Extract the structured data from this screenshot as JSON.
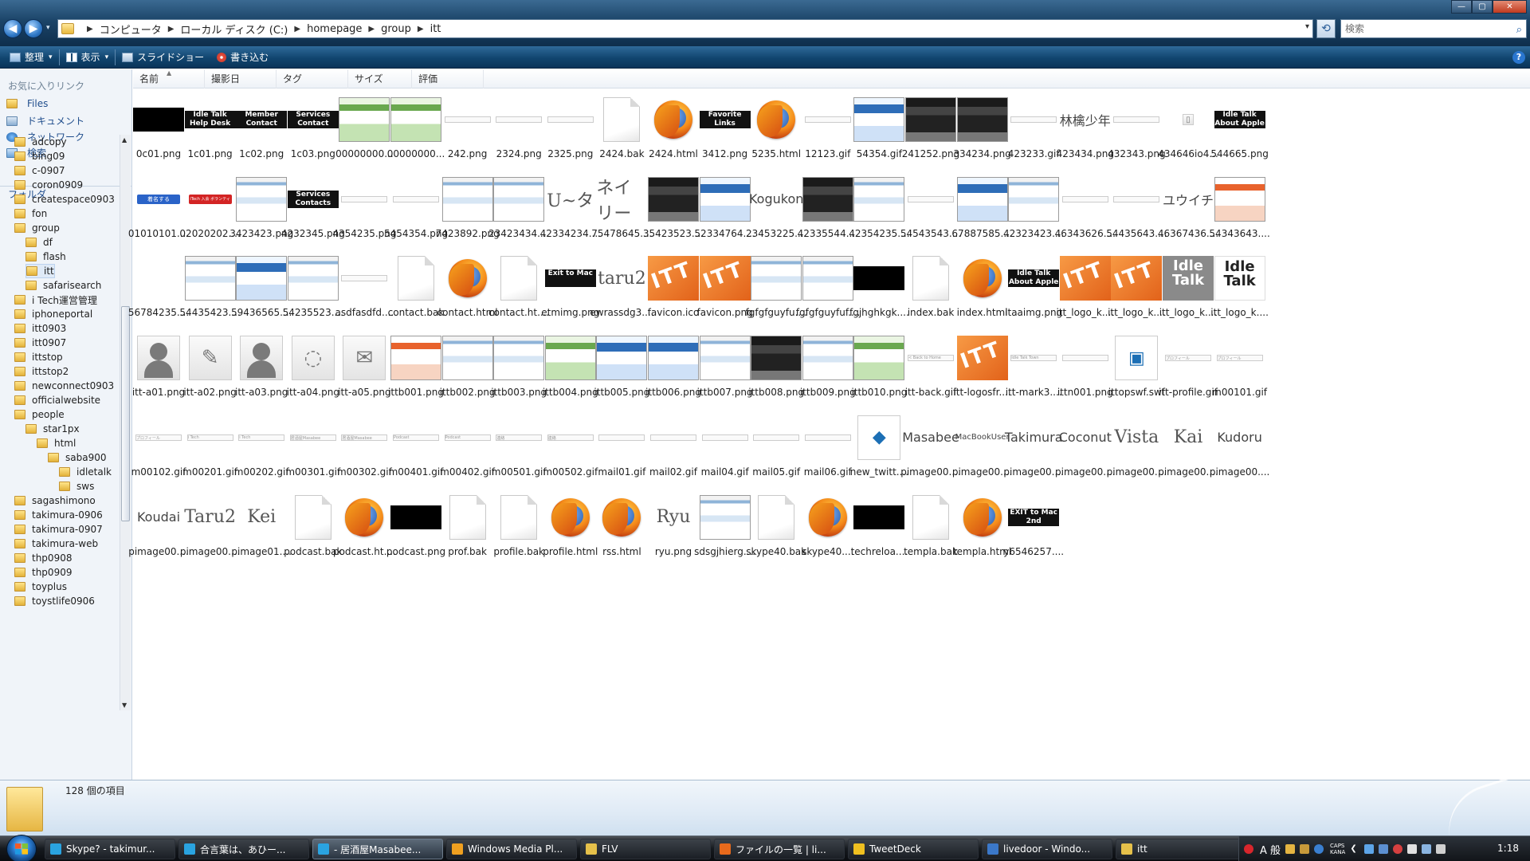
{
  "window": {
    "address": {
      "crumbs": [
        "コンピュータ",
        "ローカル ディスク (C:)",
        "homepage",
        "group",
        "itt"
      ]
    },
    "search_placeholder": "検索",
    "caption": {
      "minimize": "—",
      "maximize": "▢",
      "close": "✕"
    }
  },
  "toolbar": {
    "organize": "整理",
    "views": "表示",
    "slideshow": "スライドショー",
    "burn": "書き込む",
    "help": "?"
  },
  "nav": {
    "favorites_heading": "お気に入りリンク",
    "favorites": [
      "Files",
      "ドキュメント",
      "ネットワーク",
      "検索"
    ],
    "folders_heading": "フォルダ",
    "tree": [
      {
        "label": "adcopy",
        "level": 0
      },
      {
        "label": "bing09",
        "level": 0
      },
      {
        "label": "c-0907",
        "level": 0
      },
      {
        "label": "coron0909",
        "level": 0
      },
      {
        "label": "createspace0903",
        "level": 0
      },
      {
        "label": "fon",
        "level": 0
      },
      {
        "label": "group",
        "level": 0
      },
      {
        "label": "df",
        "level": 1
      },
      {
        "label": "flash",
        "level": 1
      },
      {
        "label": "itt",
        "level": 1,
        "selected": true
      },
      {
        "label": "safarisearch",
        "level": 1
      },
      {
        "label": "i Tech運営管理",
        "level": 0
      },
      {
        "label": "iphoneportal",
        "level": 0
      },
      {
        "label": "itt0903",
        "level": 0
      },
      {
        "label": "itt0907",
        "level": 0
      },
      {
        "label": "ittstop",
        "level": 0
      },
      {
        "label": "ittstop2",
        "level": 0
      },
      {
        "label": "newconnect0903",
        "level": 0
      },
      {
        "label": "officialwebsite",
        "level": 0
      },
      {
        "label": "people",
        "level": 0
      },
      {
        "label": "star1px",
        "level": 1
      },
      {
        "label": "html",
        "level": 2
      },
      {
        "label": "saba900",
        "level": 3
      },
      {
        "label": "idletalk",
        "level": 4
      },
      {
        "label": "sws",
        "level": 4
      },
      {
        "label": "sagashimono",
        "level": 0
      },
      {
        "label": "takimura-0906",
        "level": 0
      },
      {
        "label": "takimura-0907",
        "level": 0
      },
      {
        "label": "takimura-web",
        "level": 0
      },
      {
        "label": "thp0908",
        "level": 0
      },
      {
        "label": "thp0909",
        "level": 0
      },
      {
        "label": "toyplus",
        "level": 0
      },
      {
        "label": "toystlife0906",
        "level": 0
      }
    ]
  },
  "columns": [
    "名前",
    "撮影日",
    "タグ",
    "サイズ",
    "評価"
  ],
  "files": [
    [
      {
        "name": "0c01.png",
        "kind": "black"
      },
      {
        "name": "1c01.png",
        "kind": "dark",
        "text": "Idle Talk Help Desk"
      },
      {
        "name": "1c02.png",
        "kind": "dark",
        "text": "Member Contact"
      },
      {
        "name": "1c03.png",
        "kind": "dark",
        "text": "Services Contact"
      },
      {
        "name": "00000000...",
        "kind": "shot-green"
      },
      {
        "name": "00000000...",
        "kind": "shot-green"
      },
      {
        "name": "242.png",
        "kind": "thin"
      },
      {
        "name": "2324.png",
        "kind": "thin"
      },
      {
        "name": "2325.png",
        "kind": "thin"
      },
      {
        "name": "2424.bak",
        "kind": "page"
      },
      {
        "name": "2424.html",
        "kind": "ff"
      },
      {
        "name": "3412.png",
        "kind": "dark",
        "text": "Favorite Links"
      },
      {
        "name": "5235.html",
        "kind": "ff"
      },
      {
        "name": "12123.gif",
        "kind": "thin"
      },
      {
        "name": "54354.gif",
        "kind": "shot-blue"
      },
      {
        "name": "241252.png",
        "kind": "shot-dark"
      },
      {
        "name": "334234.png",
        "kind": "shot-dark"
      },
      {
        "name": "423233.gif",
        "kind": "thin"
      },
      {
        "name": "423434.png",
        "kind": "text-sm",
        "text": "林檎少年"
      },
      {
        "name": "432343.png",
        "kind": "thin"
      },
      {
        "name": "434646io4...",
        "kind": "glyph-sm",
        "text": "▯"
      },
      {
        "name": "544665.png",
        "kind": "dark",
        "text": "Idle Talk About Apple"
      }
    ],
    [
      {
        "name": "01010101....",
        "kind": "btn-blue",
        "text": "着名する"
      },
      {
        "name": "02020202....",
        "kind": "btn-red",
        "text": "iTech 入会 ボランティアワーク"
      },
      {
        "name": "3423423.png",
        "kind": "shot"
      },
      {
        "name": "4232345.png",
        "kind": "dark",
        "text": "Services Contacts"
      },
      {
        "name": "4354235.png",
        "kind": "thin"
      },
      {
        "name": "5454354.png",
        "kind": "thin"
      },
      {
        "name": "7423892.png",
        "kind": "shot"
      },
      {
        "name": "23423434....",
        "kind": "shot"
      },
      {
        "name": "42334234....",
        "kind": "text",
        "text": "U~タ"
      },
      {
        "name": "75478645....",
        "kind": "text",
        "text": "ネイリー"
      },
      {
        "name": "35423523....",
        "kind": "shot-dark"
      },
      {
        "name": "52334764....",
        "kind": "shot-blue"
      },
      {
        "name": "23453225....",
        "kind": "text-sm",
        "text": "Kogukon"
      },
      {
        "name": "42335544....",
        "kind": "shot-dark"
      },
      {
        "name": "42354235....",
        "kind": "shot"
      },
      {
        "name": "54543543....",
        "kind": "thin"
      },
      {
        "name": "67887585....",
        "kind": "shot-blue"
      },
      {
        "name": "42323423....",
        "kind": "shot"
      },
      {
        "name": "46343626....",
        "kind": "thin"
      },
      {
        "name": "54435643....",
        "kind": "thin"
      },
      {
        "name": "46367436....",
        "kind": "text-sm",
        "text": "ユウイチ"
      },
      {
        "name": "54343643....",
        "kind": "shot-orange"
      }
    ],
    [
      {
        "name": "56784235....",
        "kind": "none"
      },
      {
        "name": "54435423....",
        "kind": "shot"
      },
      {
        "name": "59436565....",
        "kind": "shot-blue"
      },
      {
        "name": "54235523....",
        "kind": "shot"
      },
      {
        "name": "asdfasdfd....",
        "kind": "thin"
      },
      {
        "name": "contact.bak",
        "kind": "page"
      },
      {
        "name": "contact.html",
        "kind": "ff"
      },
      {
        "name": "contact.ht....",
        "kind": "page"
      },
      {
        "name": "etmimg.png",
        "kind": "dark",
        "text": "Exit to Mac"
      },
      {
        "name": "ewrassdg3....",
        "kind": "text",
        "text": "taru2"
      },
      {
        "name": "favicon.ico",
        "kind": "itt"
      },
      {
        "name": "favicon.png",
        "kind": "itt"
      },
      {
        "name": "fgfgfguyfu....",
        "kind": "shot"
      },
      {
        "name": "fgfgfguyfuf....",
        "kind": "shot"
      },
      {
        "name": "fgjhghkgk....",
        "kind": "black"
      },
      {
        "name": "index.bak",
        "kind": "page"
      },
      {
        "name": "index.html",
        "kind": "ff"
      },
      {
        "name": "itaaimg.png",
        "kind": "dark",
        "text": "Idle Talk About Apple"
      },
      {
        "name": "itt_logo_k....",
        "kind": "itt"
      },
      {
        "name": "itt_logo_k....",
        "kind": "itt"
      },
      {
        "name": "itt_logo_k....",
        "kind": "talk",
        "text": "Idle Talk"
      },
      {
        "name": "itt_logo_k....",
        "kind": "talk-light",
        "text": "Idle Talk"
      }
    ],
    [
      {
        "name": "itt-a01.png",
        "kind": "avatar"
      },
      {
        "name": "itt-a02.png",
        "kind": "glyph",
        "text": "✎"
      },
      {
        "name": "itt-a03.png",
        "kind": "avatar"
      },
      {
        "name": "itt-a04.png",
        "kind": "glyph",
        "text": "◌"
      },
      {
        "name": "itt-a05.png",
        "kind": "glyph",
        "text": "✉"
      },
      {
        "name": "ittb001.png",
        "kind": "shot-orange"
      },
      {
        "name": "ittb002.png",
        "kind": "shot"
      },
      {
        "name": "ittb003.png",
        "kind": "shot"
      },
      {
        "name": "ittb004.png",
        "kind": "shot-green"
      },
      {
        "name": "ittb005.png",
        "kind": "shot-blue"
      },
      {
        "name": "ittb006.png",
        "kind": "shot-blue"
      },
      {
        "name": "ittb007.png",
        "kind": "shot"
      },
      {
        "name": "ittb008.png",
        "kind": "shot-dark"
      },
      {
        "name": "ittb009.png",
        "kind": "shot"
      },
      {
        "name": "ittb010.png",
        "kind": "shot-green"
      },
      {
        "name": "itt-back.gif",
        "kind": "thin",
        "text": "< Back to Home"
      },
      {
        "name": "itt-logosfr....",
        "kind": "itt"
      },
      {
        "name": "itt-mark3....",
        "kind": "thin",
        "text": "Idle Talk Town"
      },
      {
        "name": "ittn001.png",
        "kind": "thin"
      },
      {
        "name": "ittopswf.swf",
        "kind": "swf",
        "text": "▣"
      },
      {
        "name": "itt-profile.gif",
        "kind": "thin",
        "text": "プロフィール"
      },
      {
        "name": "m00101.gif",
        "kind": "thin",
        "text": "プロフィール"
      }
    ],
    [
      {
        "name": "m00102.gif",
        "kind": "thin",
        "text": "プロフィール"
      },
      {
        "name": "m00201.gif",
        "kind": "thin",
        "text": "i Tech"
      },
      {
        "name": "m00202.gif",
        "kind": "thin",
        "text": "i Tech"
      },
      {
        "name": "m00301.gif",
        "kind": "thin",
        "text": "居酒屋Masabee"
      },
      {
        "name": "m00302.gif",
        "kind": "thin",
        "text": "居酒屋Masabee"
      },
      {
        "name": "m00401.gif",
        "kind": "thin",
        "text": "Podcast"
      },
      {
        "name": "m00402.gif",
        "kind": "thin",
        "text": "Podcast"
      },
      {
        "name": "m00501.gif",
        "kind": "thin",
        "text": "連絡"
      },
      {
        "name": "m00502.gif",
        "kind": "thin",
        "text": "連絡"
      },
      {
        "name": "mail01.gif",
        "kind": "thin"
      },
      {
        "name": "mail02.gif",
        "kind": "thin"
      },
      {
        "name": "mail04.gif",
        "kind": "thin"
      },
      {
        "name": "mail05.gif",
        "kind": "thin"
      },
      {
        "name": "mail06.gif",
        "kind": "thin"
      },
      {
        "name": "new_twitt....",
        "kind": "swf",
        "text": "◆"
      },
      {
        "name": "pimage00....",
        "kind": "text-sm",
        "text": "Masabee"
      },
      {
        "name": "pimage00....",
        "kind": "text-xs",
        "text": "MacBookUser"
      },
      {
        "name": "pimage00....",
        "kind": "text-sm",
        "text": "Takimura"
      },
      {
        "name": "pimage00....",
        "kind": "text-sm",
        "text": "Coconut"
      },
      {
        "name": "pimage00....",
        "kind": "text",
        "text": "Vista"
      },
      {
        "name": "pimage00....",
        "kind": "text",
        "text": "Kai"
      },
      {
        "name": "pimage00....",
        "kind": "text-sm",
        "text": "Kudoru"
      }
    ],
    [
      {
        "name": "pimage00....",
        "kind": "text-sm",
        "text": "Koudai"
      },
      {
        "name": "pimage00....",
        "kind": "text",
        "text": "Taru2"
      },
      {
        "name": "pimage01....",
        "kind": "text",
        "text": "Kei"
      },
      {
        "name": "podcast.bak",
        "kind": "page"
      },
      {
        "name": "podcast.ht....",
        "kind": "ff"
      },
      {
        "name": "podcast.png",
        "kind": "black"
      },
      {
        "name": "prof.bak",
        "kind": "page"
      },
      {
        "name": "profile.bak",
        "kind": "page"
      },
      {
        "name": "profile.html",
        "kind": "ff"
      },
      {
        "name": "rss.html",
        "kind": "ff"
      },
      {
        "name": "ryu.png",
        "kind": "text",
        "text": "Ryu"
      },
      {
        "name": "sdsgjhierg....",
        "kind": "shot"
      },
      {
        "name": "skype40.bak",
        "kind": "page"
      },
      {
        "name": "skype40....",
        "kind": "ff"
      },
      {
        "name": "techreloa....",
        "kind": "black"
      },
      {
        "name": "templa.bak",
        "kind": "page"
      },
      {
        "name": "templa.html",
        "kind": "ff"
      },
      {
        "name": "y6546257....",
        "kind": "dark",
        "text": "EXIT to Mac 2nd"
      }
    ]
  ],
  "details": {
    "item_count": "128 個の項目"
  },
  "taskbar": {
    "tasks": [
      {
        "label": "Skype? - takimur...",
        "color": "#2aa3e0"
      },
      {
        "label": "合言葉は、あひー...",
        "color": "#2aa3e0"
      },
      {
        "label": "- 居酒屋Masabee...",
        "color": "#2aa3e0",
        "active": true
      },
      {
        "label": "Windows Media Pl...",
        "color": "#f0a020"
      },
      {
        "label": "FLV",
        "color": "#e5c04a"
      },
      {
        "label": "ファイルの一覧 | li...",
        "color": "#e86a1c"
      },
      {
        "label": "TweetDeck",
        "color": "#f0c020"
      },
      {
        "label": "livedoor - Windo...",
        "color": "#3b78c9"
      },
      {
        "label": "itt",
        "color": "#e5c04a"
      }
    ],
    "ime": "A 般",
    "caps": "CAPS",
    "kana": "KANA",
    "clock": "1:18"
  }
}
